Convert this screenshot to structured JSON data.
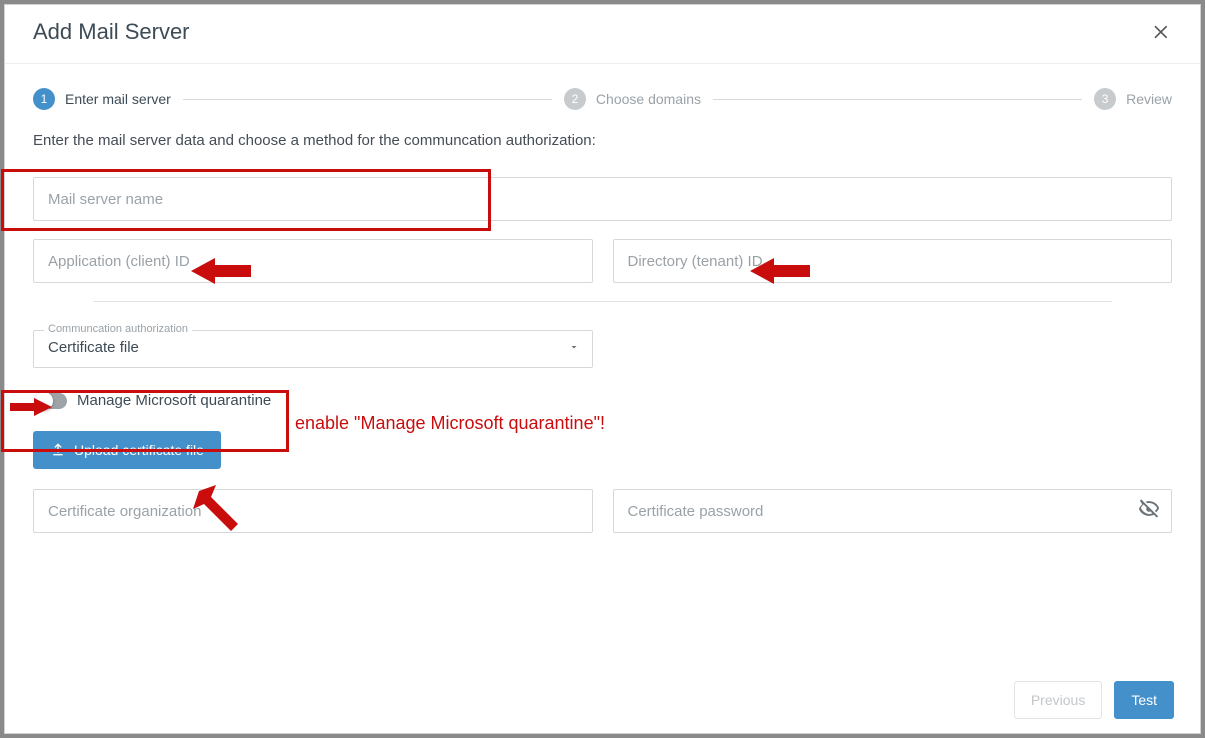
{
  "window": {
    "title": "Add Mail Server"
  },
  "stepper": {
    "step1": {
      "num": "1",
      "label": "Enter mail server"
    },
    "step2": {
      "num": "2",
      "label": "Choose domains"
    },
    "step3": {
      "num": "3",
      "label": "Review"
    }
  },
  "intro": "Enter the mail server data and choose a method for the communcation authorization:",
  "fields": {
    "server_name": {
      "placeholder": "Mail server name",
      "value": ""
    },
    "client_id": {
      "placeholder": "Application (client) ID",
      "value": ""
    },
    "tenant_id": {
      "placeholder": "Directory (tenant) ID",
      "value": ""
    },
    "cert_org": {
      "placeholder": "Certificate organization",
      "value": ""
    },
    "cert_pass": {
      "placeholder": "Certificate password",
      "value": ""
    }
  },
  "auth_select": {
    "legend": "Communcation authorization",
    "value": "Certificate file"
  },
  "toggle": {
    "label": "Manage Microsoft quarantine",
    "on": false
  },
  "buttons": {
    "upload": "Upload certificate file",
    "previous": "Previous",
    "test": "Test"
  },
  "annotation": {
    "text": "enable \"Manage Microsoft quarantine\"!"
  }
}
